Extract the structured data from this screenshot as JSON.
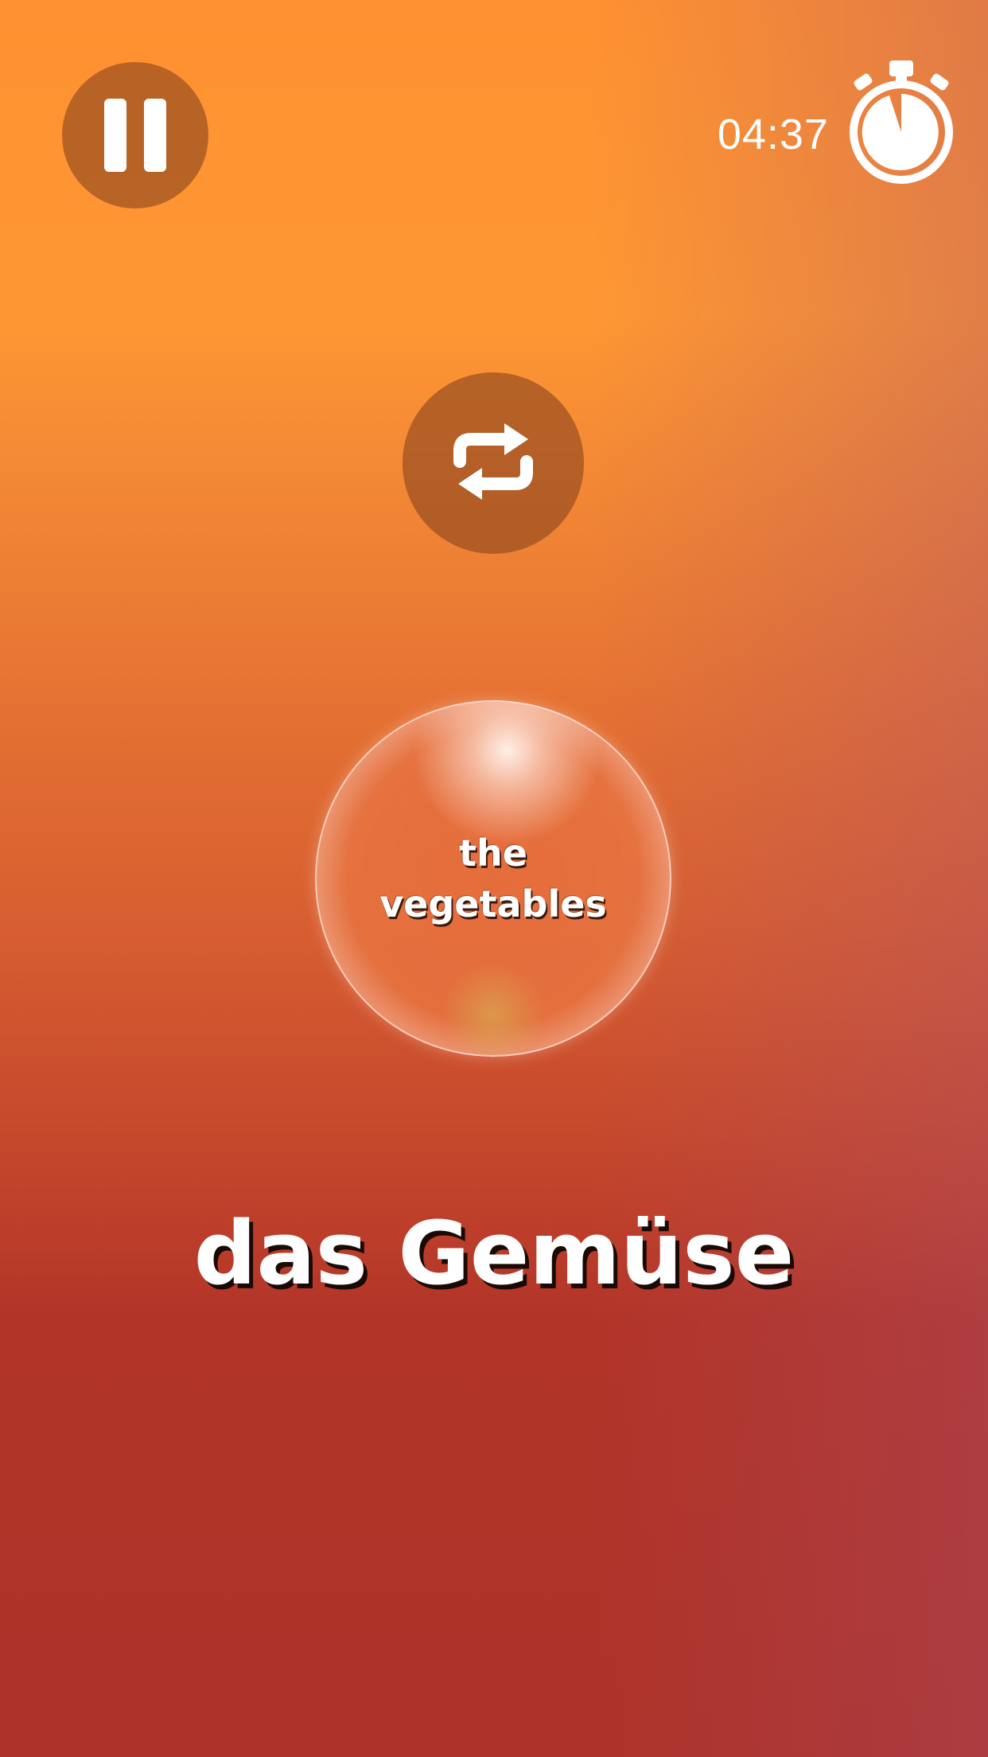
{
  "header": {
    "pause_icon": "pause-icon",
    "timer": "04:37",
    "stopwatch_icon": "stopwatch-icon"
  },
  "controls": {
    "repeat_icon": "repeat-icon"
  },
  "bubble": {
    "line1": "the",
    "line2": "vegetables"
  },
  "word": {
    "text": "das Gemüse"
  },
  "colors": {
    "background_top": "#fe9131",
    "background_bottom": "#ad3229",
    "button_fill": "#8c461e",
    "text": "#ffffff"
  }
}
